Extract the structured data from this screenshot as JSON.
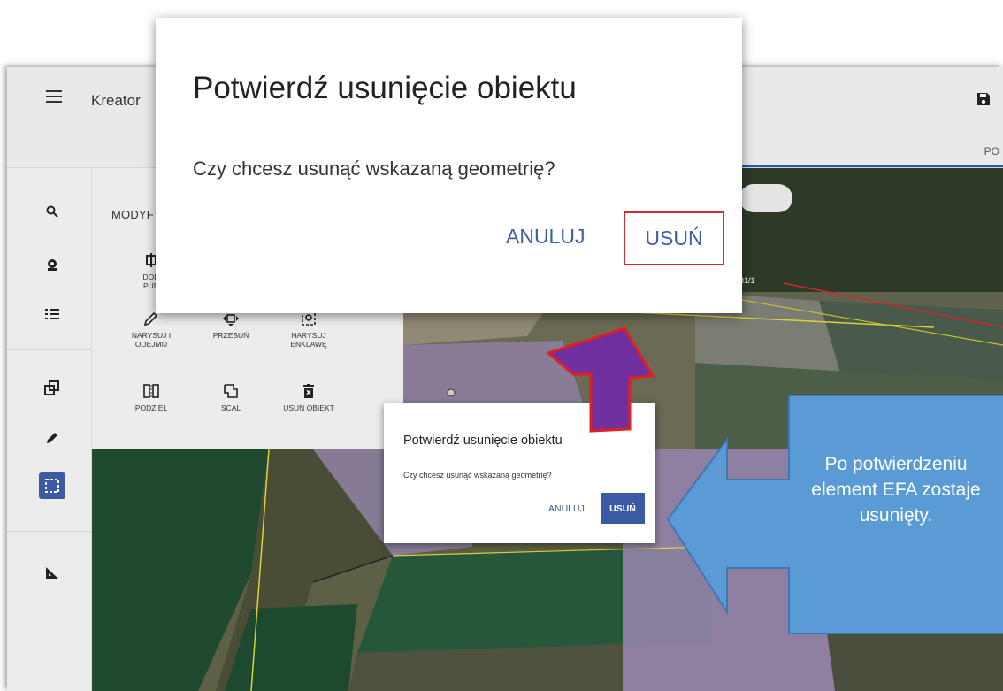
{
  "app": {
    "title": "Kreator",
    "tab_label": "PO",
    "tools_header": "MODYF",
    "tools": [
      {
        "label": "DOD PUN",
        "icon": "add-point-icon"
      },
      {
        "label": "NARYSUJ I ODEJMIJ",
        "icon": "pencil-icon"
      },
      {
        "label": "PRZESUŃ",
        "icon": "move-icon"
      },
      {
        "label": "NARYSUJ ENKLAWĘ",
        "icon": "enclave-icon"
      },
      {
        "label": "PODZIEL",
        "icon": "split-icon"
      },
      {
        "label": "SCAL",
        "icon": "merge-icon"
      },
      {
        "label": "USUŃ OBIEKT",
        "icon": "delete-object-icon"
      }
    ],
    "map_label": "31/1"
  },
  "dialog_large": {
    "title": "Potwierdź usunięcie obiektu",
    "message": "Czy chcesz usunąć wskazaną geometrię?",
    "cancel_label": "ANULUJ",
    "delete_label": "USUŃ"
  },
  "dialog_small": {
    "title": "Potwierdź usunięcie obiektu",
    "message": "Czy chcesz usunąć wskazaną geometrię?",
    "cancel_label": "ANULUJ",
    "delete_label": "USUŃ"
  },
  "callout": {
    "text": "Po potwierdzeniu element EFA zostaje usunięty."
  },
  "colors": {
    "primary": "#3b5aa6",
    "highlight_border": "#d62a2a",
    "callout": "#5b9bd5",
    "arrow": "#7030a0"
  }
}
